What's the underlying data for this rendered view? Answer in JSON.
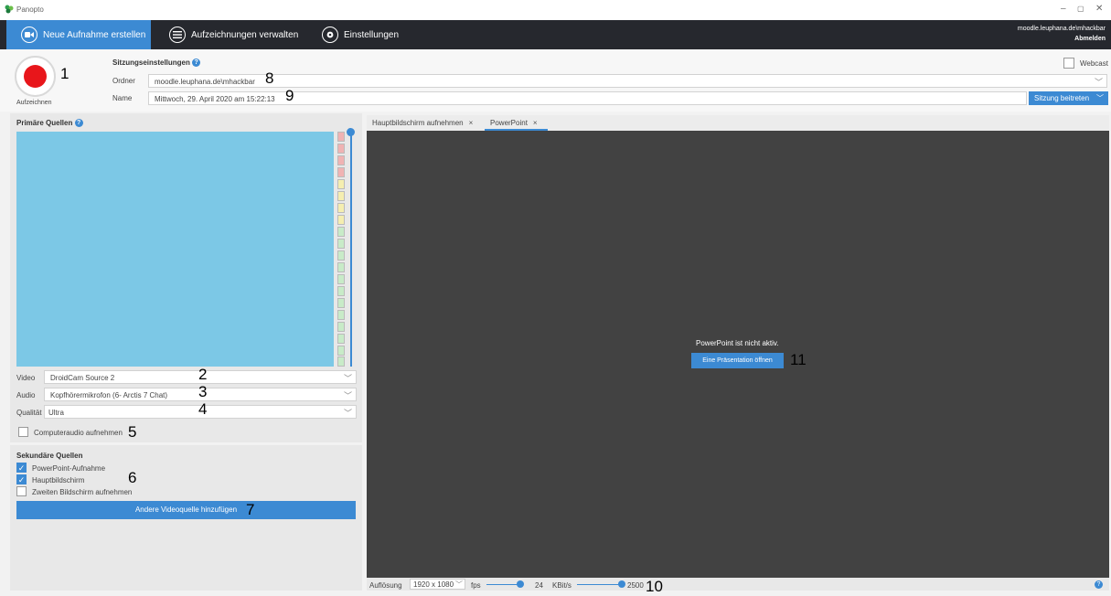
{
  "titlebar": {
    "app_title": "Panopto",
    "min": "–",
    "restore": "▢",
    "close": "✕"
  },
  "nav": {
    "tabs": [
      {
        "label": "Neue Aufnahme erstellen",
        "icon": "camera-icon"
      },
      {
        "label": "Aufzeichnungen verwalten",
        "icon": "list-icon"
      },
      {
        "label": "Einstellungen",
        "icon": "gear-icon"
      }
    ],
    "user": "moodle.leuphana.de\\mhackbar",
    "logout": "Abmelden"
  },
  "record": {
    "label": "Aufzeichnen"
  },
  "session": {
    "title": "Sitzungseinstellungen",
    "folder_label": "Ordner",
    "folder_value": "moodle.leuphana.de\\mhackbar",
    "name_label": "Name",
    "name_value": "Mittwoch, 29. April 2020 am 15:22:13",
    "webcast": "Webcast",
    "join": "Sitzung beitreten"
  },
  "primary": {
    "title": "Primäre Quellen",
    "video_label": "Video",
    "video_value": "DroidCam Source 2",
    "audio_label": "Audio",
    "audio_value": "Kopfhörermikrofon (6- Arctis 7 Chat)",
    "quality_label": "Qualität",
    "quality_value": "Ultra",
    "computer_audio": "Computeraudio aufnehmen"
  },
  "secondary": {
    "title": "Sekundäre Quellen",
    "items": [
      {
        "label": "PowerPoint-Aufnahme",
        "checked": true
      },
      {
        "label": "Hauptbildschirm",
        "checked": true
      },
      {
        "label": "Zweiten Bildschirm aufnehmen",
        "checked": false
      }
    ],
    "add_button": "Andere Videoquelle hinzufügen"
  },
  "preview_tabs": [
    {
      "label": "Hauptbildschirm aufnehmen",
      "close": "×"
    },
    {
      "label": "PowerPoint",
      "close": "×"
    }
  ],
  "ppt": {
    "message": "PowerPoint ist nicht aktiv.",
    "button": "Eine Präsentation öffnen"
  },
  "bottom": {
    "resolution_label": "Auflösung",
    "resolution_value": "1920 x 1080",
    "fps_label": "fps",
    "fps_value": "24",
    "kbit_label": "KBit/s",
    "kbit_value": "2500"
  },
  "annotations": [
    "1",
    "2",
    "3",
    "4",
    "5",
    "6",
    "7",
    "8",
    "9",
    "10",
    "11"
  ],
  "colors": {
    "accent": "#3c8ad3",
    "navbar": "#26282e",
    "record": "#e8161b",
    "preview": "#7cc8e6",
    "dark_preview": "#424242"
  }
}
